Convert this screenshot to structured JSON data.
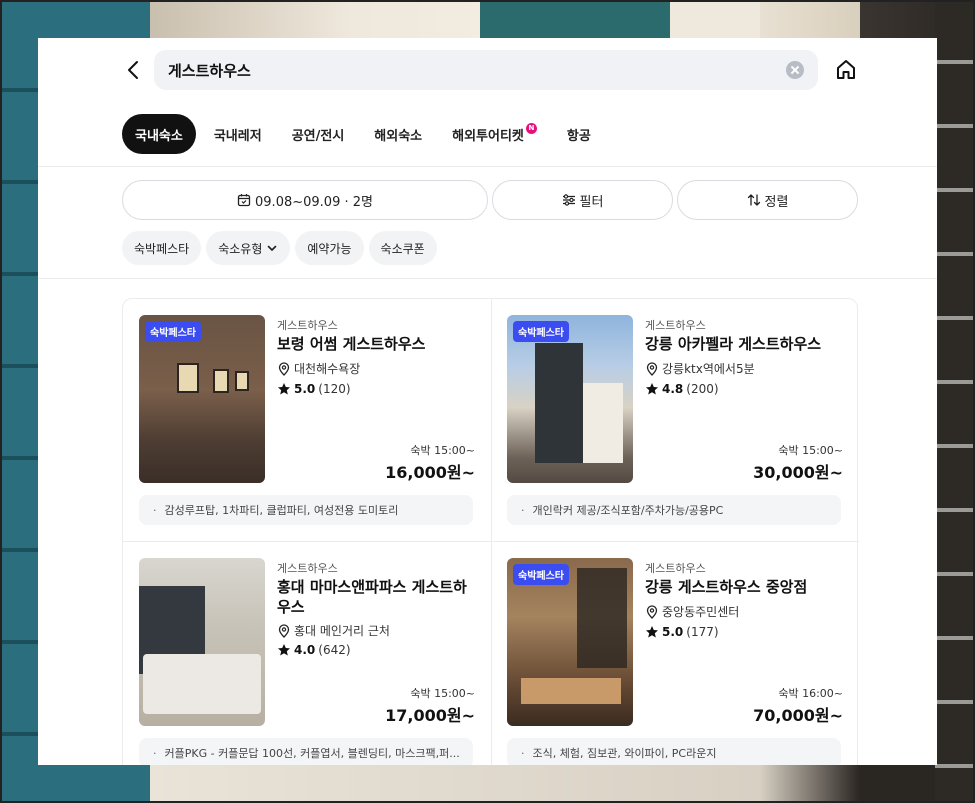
{
  "search": {
    "query": "게스트하우스"
  },
  "tabs": [
    {
      "label": "국내숙소",
      "active": true
    },
    {
      "label": "국내레저",
      "active": false
    },
    {
      "label": "공연/전시",
      "active": false
    },
    {
      "label": "해외숙소",
      "active": false
    },
    {
      "label": "해외투어티켓",
      "active": false,
      "badge": "N"
    },
    {
      "label": "항공",
      "active": false
    }
  ],
  "filters": {
    "date_guests": "09.08~09.09 · 2명",
    "filter_label": "필터",
    "sort_label": "정렬"
  },
  "chips": [
    {
      "label": "숙박페스타"
    },
    {
      "label": "숙소유형"
    },
    {
      "label": "예약가능"
    },
    {
      "label": "숙소쿠폰"
    }
  ],
  "listings": [
    {
      "badge": "숙박페스타",
      "category": "게스트하우스",
      "name": "보령 어썸 게스트하우스",
      "location": "대천해수욕장",
      "rating": "5.0",
      "reviews": "(120)",
      "checkin": "숙박 15:00~",
      "price": "16,000원~",
      "amenities": "감성루프탑, 1차파티, 클럽파티, 여성전용 도미토리"
    },
    {
      "badge": "숙박페스타",
      "category": "게스트하우스",
      "name": "강릉 아카펠라 게스트하우스",
      "location": "강릉ktx역에서5분",
      "rating": "4.8",
      "reviews": "(200)",
      "checkin": "숙박 15:00~",
      "price": "30,000원~",
      "amenities": "개인락커 제공/조식포함/주차가능/공용PC"
    },
    {
      "badge": "",
      "category": "게스트하우스",
      "name": "홍대 마마스앤파파스 게스트하우스",
      "location": "홍대 메인거리 근처",
      "rating": "4.0",
      "reviews": "(642)",
      "checkin": "숙박 15:00~",
      "price": "17,000원~",
      "amenities": "커플PKG - 커플문답 100선, 커플엽서, 블렌딩티, 마스크팩,퍼..."
    },
    {
      "badge": "숙박페스타",
      "category": "게스트하우스",
      "name": "강릉 게스트하우스 중앙점",
      "location": "중앙동주민센터",
      "rating": "5.0",
      "reviews": "(177)",
      "checkin": "숙박 16:00~",
      "price": "70,000원~",
      "amenities": "조식, 체험, 짐보관, 와이파이, PC라운지"
    }
  ],
  "icons": {
    "back": "chevron-left-icon",
    "clear": "clear-icon",
    "home": "home-icon",
    "calendar": "calendar-icon",
    "filter": "sliders-icon",
    "sort": "sort-icon",
    "location": "map-pin-icon",
    "star": "star-icon",
    "chevron": "chevron-down-icon"
  },
  "colors": {
    "active_tab": "#111111",
    "badge": "#3b4cf0",
    "new_badge": "#e5117f",
    "chip_bg": "#f2f3f5"
  }
}
